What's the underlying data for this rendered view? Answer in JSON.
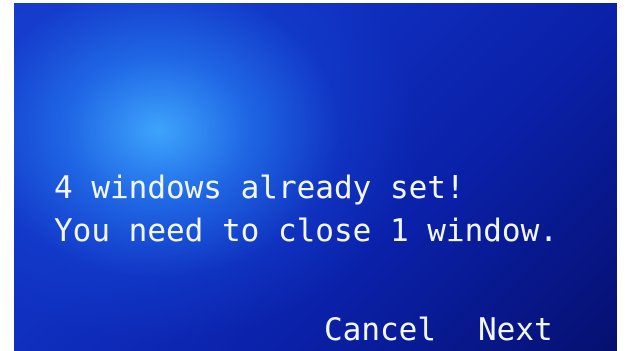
{
  "dialog": {
    "message_lines": [
      "4 windows already set!",
      "You need to close 1 window."
    ]
  },
  "buttons": {
    "cancel_label": "Cancel",
    "next_label": "Next"
  },
  "colors": {
    "background_dark": "#061070",
    "background_mid": "#1030c0",
    "glow": "#40aaff",
    "text": "#f2f6ff"
  }
}
